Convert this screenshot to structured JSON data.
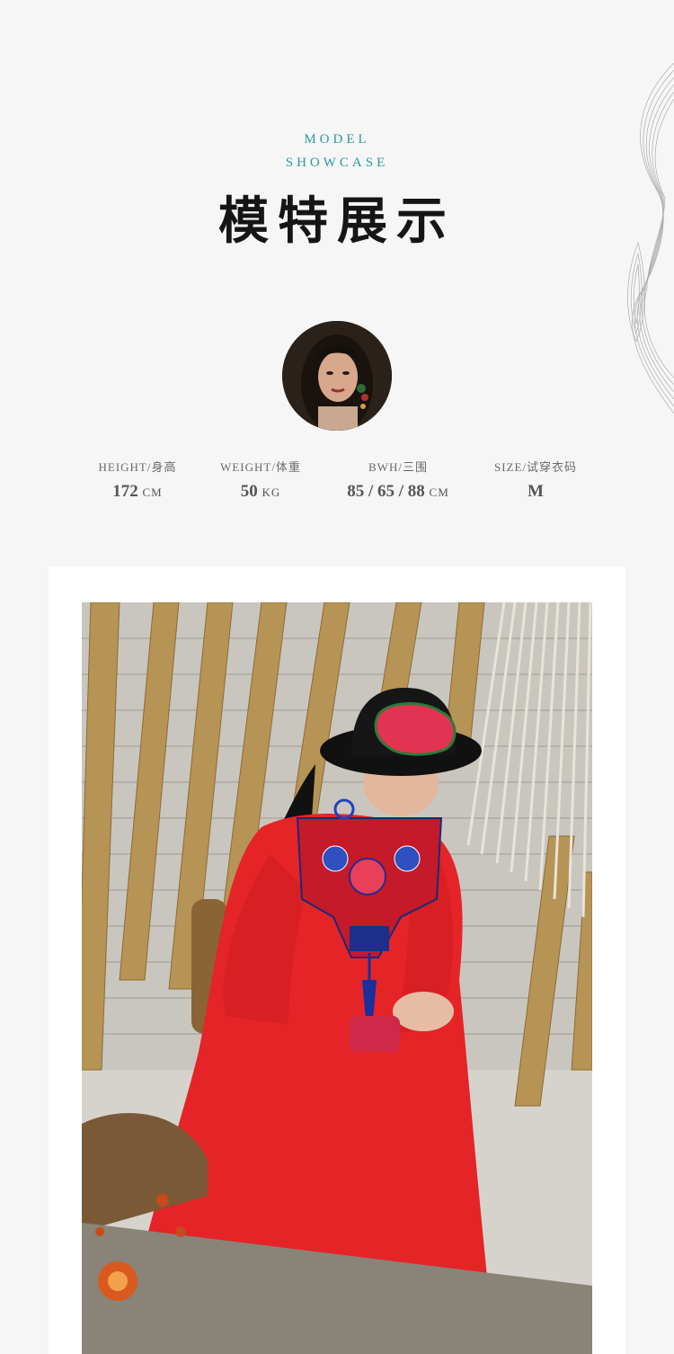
{
  "header": {
    "en_line1": "MODEL",
    "en_line2": "SHOWCASE",
    "cn_title": "模特展示"
  },
  "model": {
    "stats": [
      {
        "label": "HEIGHT/身高",
        "value": "172",
        "unit": "CM"
      },
      {
        "label": "WEIGHT/体重",
        "value": "50",
        "unit": "KG"
      },
      {
        "label": "BWH/三围",
        "value": "85 / 65 / 88",
        "unit": "CM"
      },
      {
        "label": "SIZE/试穿衣码",
        "value": "M",
        "unit": ""
      }
    ]
  },
  "colors": {
    "accent_teal": "#2a9aa1",
    "dress_red": "#e52428",
    "background": "#f6f6f6"
  }
}
